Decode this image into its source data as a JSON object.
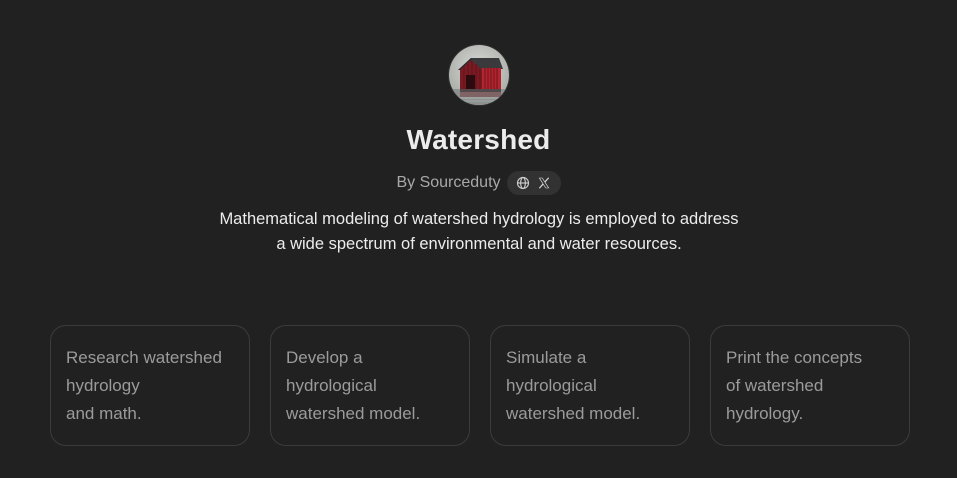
{
  "gpt": {
    "name": "Watershed",
    "author_line": "By Sourceduty",
    "social_icons": [
      "globe-icon",
      "x-logo-icon"
    ],
    "description_line_1": "Mathematical modeling of watershed hydrology is employed to address",
    "description_line_2": "a wide spectrum of environmental and water resources."
  },
  "starters": [
    {
      "text": "Research watershed\nhydrology\nand math."
    },
    {
      "text": "Develop a\nhydrological\nwatershed model."
    },
    {
      "text": "Simulate a\nhydrological\nwatershed model."
    },
    {
      "text": "Print the concepts\nof watershed\nhydrology."
    }
  ],
  "colors": {
    "background": "#212121",
    "title": "#ececec",
    "muted_text": "#a8a8a8",
    "starter_text": "#9b9b9b",
    "starter_border": "#3c3c3c",
    "pill_background": "#323232"
  }
}
